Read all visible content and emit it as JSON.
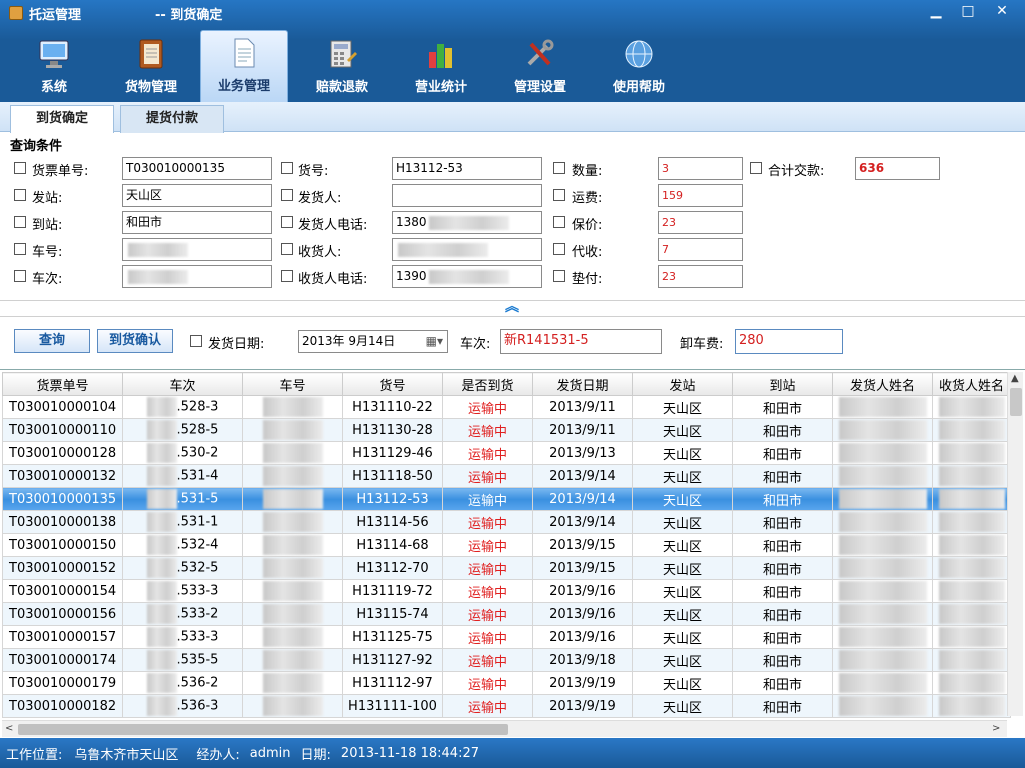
{
  "window": {
    "app_title": "托运管理",
    "doc_title": "--  到货确定"
  },
  "toolbar": [
    {
      "label": "系统",
      "icon": "monitor-icon"
    },
    {
      "label": "货物管理",
      "icon": "ledger-icon"
    },
    {
      "label": "业务管理",
      "icon": "document-icon"
    },
    {
      "label": "赔款退款",
      "icon": "calculator-icon"
    },
    {
      "label": "营业统计",
      "icon": "bar-chart-icon"
    },
    {
      "label": "管理设置",
      "icon": "tools-icon"
    },
    {
      "label": "使用帮助",
      "icon": "globe-icon"
    }
  ],
  "tabs": [
    "到货确定",
    "提货付款"
  ],
  "query": {
    "title": "查询条件",
    "waybill_label": "货票单号:",
    "waybill_value": "T030010000135",
    "goods_no_label": "货号:",
    "goods_no_value": "H13112-53",
    "qty_label": "数量:",
    "qty_value": "3",
    "total_label": "合计交款:",
    "total_value": "636",
    "from_label": "发站:",
    "from_value": "天山区",
    "sender_label": "发货人:",
    "freight_label": "运费:",
    "freight_value": "159",
    "to_label": "到站:",
    "to_value": "和田市",
    "sender_phone_label": "发货人电话:",
    "sender_phone_value": "1380",
    "insure_label": "保价:",
    "insure_value": "23",
    "vehicle_label": "车号:",
    "receiver_label": "收货人:",
    "cod_label": "代收:",
    "cod_value": "7",
    "trip_label": "车次:",
    "receiver_phone_label": "收货人电话:",
    "receiver_phone_value": "1390",
    "advance_label": "垫付:",
    "advance_value": "23"
  },
  "actions": {
    "query_btn": "查询",
    "confirm_btn": "到货确认",
    "ship_date_label": "发货日期:",
    "ship_date_value": "2013年  9月14日",
    "trip_label": "车次:",
    "trip_value": "新R141531-5",
    "unload_label": "卸车费:",
    "unload_value": "280"
  },
  "grid": {
    "columns": [
      "货票单号",
      "车次",
      "车号",
      "货号",
      "是否到货",
      "发货日期",
      "发站",
      "到站",
      "发货人姓名",
      "收货人姓名"
    ],
    "rows": [
      [
        "T030010000104",
        ".528-3",
        "H131110-22",
        "运输中",
        "2013/9/11",
        "天山区",
        "和田市"
      ],
      [
        "T030010000110",
        ".528-5",
        "H131130-28",
        "运输中",
        "2013/9/11",
        "天山区",
        "和田市"
      ],
      [
        "T030010000128",
        ".530-2",
        "H131129-46",
        "运输中",
        "2013/9/13",
        "天山区",
        "和田市"
      ],
      [
        "T030010000132",
        ".531-4",
        "H131118-50",
        "运输中",
        "2013/9/14",
        "天山区",
        "和田市"
      ],
      [
        "T030010000135",
        ".531-5",
        "H13112-53",
        "运输中",
        "2013/9/14",
        "天山区",
        "和田市"
      ],
      [
        "T030010000138",
        ".531-1",
        "H13114-56",
        "运输中",
        "2013/9/14",
        "天山区",
        "和田市"
      ],
      [
        "T030010000150",
        ".532-4",
        "H13114-68",
        "运输中",
        "2013/9/15",
        "天山区",
        "和田市"
      ],
      [
        "T030010000152",
        ".532-5",
        "H13112-70",
        "运输中",
        "2013/9/15",
        "天山区",
        "和田市"
      ],
      [
        "T030010000154",
        ".533-3",
        "H131119-72",
        "运输中",
        "2013/9/16",
        "天山区",
        "和田市"
      ],
      [
        "T030010000156",
        ".533-2",
        "H13115-74",
        "运输中",
        "2013/9/16",
        "天山区",
        "和田市"
      ],
      [
        "T030010000157",
        ".533-3",
        "H131125-75",
        "运输中",
        "2013/9/16",
        "天山区",
        "和田市"
      ],
      [
        "T030010000174",
        ".535-5",
        "H131127-92",
        "运输中",
        "2013/9/18",
        "天山区",
        "和田市"
      ],
      [
        "T030010000179",
        ".536-2",
        "H131112-97",
        "运输中",
        "2013/9/19",
        "天山区",
        "和田市"
      ],
      [
        "T030010000182",
        ".536-3",
        "H131111-100",
        "运输中",
        "2013/9/19",
        "天山区",
        "和田市"
      ]
    ],
    "selected_index": 4
  },
  "status": {
    "location_label": "工作位置:",
    "location_value": "乌鲁木齐市天山区",
    "operator_label": "经办人:",
    "operator_value": "admin",
    "date_label": "日期:",
    "date_value": "2013-11-18 18:44:27"
  },
  "colors": {
    "accent": "#1a5a98",
    "selected_row": "#3a90e0",
    "status_red": "#e02020"
  }
}
